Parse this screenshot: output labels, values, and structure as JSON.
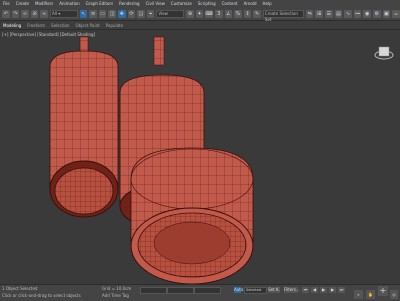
{
  "menu": {
    "items": [
      "File",
      "Create",
      "Modifiers",
      "Animation",
      "Graph Editors",
      "Rendering",
      "Civil View",
      "Customize",
      "Scripting",
      "Content",
      "Arnold",
      "Help"
    ]
  },
  "toolbar": {
    "select_view": "View",
    "select_set": "Create Selection Set"
  },
  "ribbon": {
    "tabs": [
      "Modeling",
      "Freeform",
      "Selection",
      "Object Paint",
      "Populate"
    ]
  },
  "viewport": {
    "label": "[+] [Perspective] [Standard] [Default Shading]"
  },
  "status": {
    "objects_selected": "1 Object Selected",
    "prompt": "Click or click-and-drag to select objects",
    "grid": "Grid = 10.0cm",
    "add_time_tag": "Add Time Tag",
    "auto_label": "Auto",
    "selected_label": "Selected",
    "set_key_label": "Set K.",
    "filters_label": "Filters..."
  },
  "colors": {
    "mesh_fill": "#c25a4c",
    "mesh_wire": "#3a0e0a",
    "viewport_bg": "#3a3a3a"
  }
}
